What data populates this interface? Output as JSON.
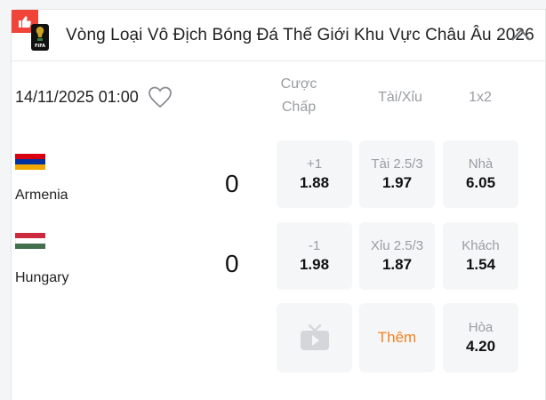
{
  "league": {
    "title": "Vòng Loại Vô Địch Bóng Đá Thế Giới Khu Vực Châu Âu 2026",
    "logo_text": "FIFA"
  },
  "match": {
    "kickoff": "14/11/2025 01:00"
  },
  "columns": {
    "handicap": "Cược Chấp",
    "over_under": "Tài/Xỉu",
    "one_x_two": "1x2"
  },
  "home": {
    "name": "Armenia",
    "score": "0",
    "flag_colors": [
      "#d90012",
      "#0033a0",
      "#f2a800"
    ],
    "handicap": {
      "line": "+1",
      "odds": "1.88"
    },
    "over_under": {
      "label": "Tài 2.5/3",
      "odds": "1.97"
    },
    "one_x_two": {
      "label": "Nhà",
      "odds": "6.05"
    }
  },
  "away": {
    "name": "Hungary",
    "score": "0",
    "flag_colors": [
      "#cd2a3e",
      "#ffffff",
      "#436f4d"
    ],
    "handicap": {
      "line": "-1",
      "odds": "1.98"
    },
    "over_under": {
      "label": "Xỉu 2.5/3",
      "odds": "1.87"
    },
    "one_x_two": {
      "label": "Khách",
      "odds": "1.54"
    }
  },
  "draw": {
    "label": "Hòa",
    "odds": "4.20"
  },
  "more_label": "Thêm",
  "icons": {
    "badge": "thumbs-up-icon",
    "collapse": "chevron-up-icon",
    "favorite": "heart-icon",
    "live": "tv-play-icon"
  },
  "colors": {
    "accent": "#f5821f",
    "badge": "#f04438",
    "muted": "#9a9da3"
  }
}
